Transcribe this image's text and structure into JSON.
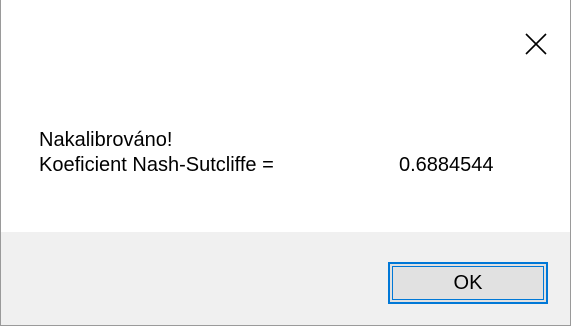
{
  "dialog": {
    "message_line1": "Nakalibrováno!",
    "nse_label": "Koeficient Nash-Sutcliffe =",
    "nse_value": "0.6884544",
    "close_icon": "close-icon",
    "ok_label": "OK",
    "accent_color": "#0078d7",
    "footer_color": "#f0f0f0"
  }
}
